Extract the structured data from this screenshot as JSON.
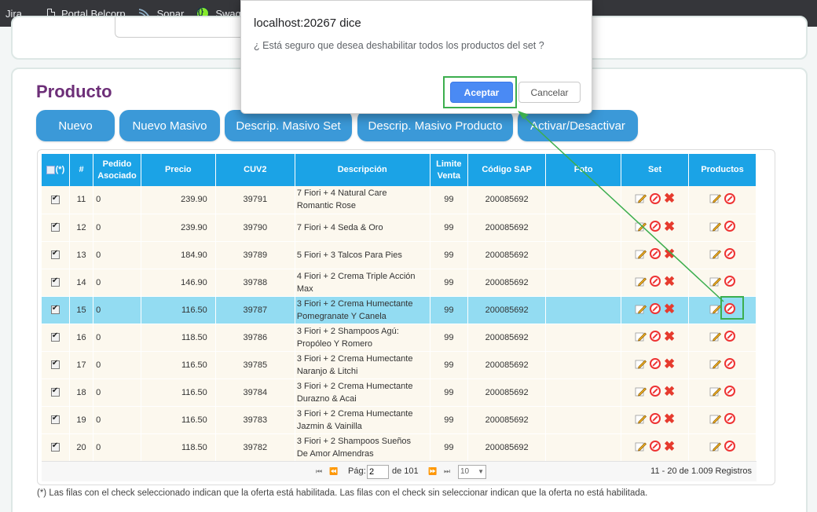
{
  "bookmarks": [
    {
      "label": "Jira",
      "icon": "none"
    },
    {
      "label": "Portal Belcorp",
      "icon": "document-icon"
    },
    {
      "label": "Sonar",
      "icon": "sonar-icon"
    },
    {
      "label": "Swagger",
      "icon": "swagger-icon"
    }
  ],
  "page": {
    "title": "Producto"
  },
  "toolbar": {
    "nuevo": "Nuevo",
    "nuevo_masivo": "Nuevo Masivo",
    "descrip_masivo_set": "Descrip. Masivo Set",
    "descrip_masivo_producto": "Descrip. Masivo Producto",
    "activar_desactivar": "Activar/Desactivar"
  },
  "grid": {
    "headers": {
      "check": "(*)",
      "num": "#",
      "pedido_l1": "Pedido",
      "pedido_l2": "Asociado",
      "precio": "Precio",
      "cuv2": "CUV2",
      "descripcion": "Descripción",
      "limite_l1": "Limite",
      "limite_l2": "Venta",
      "sap": "Código SAP",
      "foto": "Foto",
      "set": "Set",
      "productos": "Productos"
    },
    "rows": [
      {
        "num": "11",
        "pedido": "0",
        "precio": "239.90",
        "cuv2": "39791",
        "desc1": "7 Fiori + 4 Natural Care",
        "desc2": "Romantic Rose",
        "limite": "99",
        "sap": "200085692"
      },
      {
        "num": "12",
        "pedido": "0",
        "precio": "239.90",
        "cuv2": "39790",
        "desc1": "7 Fiori + 4 Seda & Oro",
        "desc2": "",
        "limite": "99",
        "sap": "200085692"
      },
      {
        "num": "13",
        "pedido": "0",
        "precio": "184.90",
        "cuv2": "39789",
        "desc1": "5 Fiori + 3 Talcos Para Pies",
        "desc2": "",
        "limite": "99",
        "sap": "200085692"
      },
      {
        "num": "14",
        "pedido": "0",
        "precio": "146.90",
        "cuv2": "39788",
        "desc1": "4 Fiori + 2 Crema Triple Acción",
        "desc2": "Max",
        "limite": "99",
        "sap": "200085692"
      },
      {
        "num": "15",
        "pedido": "0",
        "precio": "116.50",
        "cuv2": "39787",
        "desc1": "3 Fiori + 2 Crema Humectante",
        "desc2": "Pomegranate Y Canela",
        "limite": "99",
        "sap": "200085692"
      },
      {
        "num": "16",
        "pedido": "0",
        "precio": "118.50",
        "cuv2": "39786",
        "desc1": "3 Fiori + 2 Shampoos Agú:",
        "desc2": "Propóleo Y Romero",
        "limite": "99",
        "sap": "200085692"
      },
      {
        "num": "17",
        "pedido": "0",
        "precio": "116.50",
        "cuv2": "39785",
        "desc1": "3 Fiori + 2 Crema Humectante",
        "desc2": "Naranjo & Litchi",
        "limite": "99",
        "sap": "200085692"
      },
      {
        "num": "18",
        "pedido": "0",
        "precio": "116.50",
        "cuv2": "39784",
        "desc1": "3 Fiori + 2 Crema Humectante",
        "desc2": "Durazno & Acai",
        "limite": "99",
        "sap": "200085692"
      },
      {
        "num": "19",
        "pedido": "0",
        "precio": "116.50",
        "cuv2": "39783",
        "desc1": "3 Fiori + 2 Crema Humectante",
        "desc2": "Jazmin & Vainilla",
        "limite": "99",
        "sap": "200085692"
      },
      {
        "num": "20",
        "pedido": "0",
        "precio": "118.50",
        "cuv2": "39782",
        "desc1": "3 Fiori + 2 Shampoos Sueños",
        "desc2": "De Amor Almendras",
        "limite": "99",
        "sap": "200085692"
      }
    ],
    "selected_row": "15"
  },
  "pager": {
    "first": "⏮",
    "prev": "⏪",
    "page_label": "Pág:",
    "page_value": "2",
    "of_label": "de 101",
    "next": "⏩",
    "last": "⏭",
    "page_size": "10",
    "info": "11 - 20 de 1.009 Registros"
  },
  "footnote": "(*) Las filas con el check seleccionado indican que la oferta está habilitada. Las filas con el check sin seleccionar indican que la oferta no está habilitada.",
  "dialog": {
    "title": "localhost:20267 dice",
    "message": "¿ Está seguro que desea deshabilitar todos los productos del set ?",
    "ok": "Aceptar",
    "cancel": "Cancelar"
  },
  "colors": {
    "header_blue": "#1ba3e6",
    "button_blue": "#3b99d8",
    "title_purple": "#6d2f78",
    "highlight_green": "#3cae4e",
    "selected_row": "#93dcf2"
  }
}
